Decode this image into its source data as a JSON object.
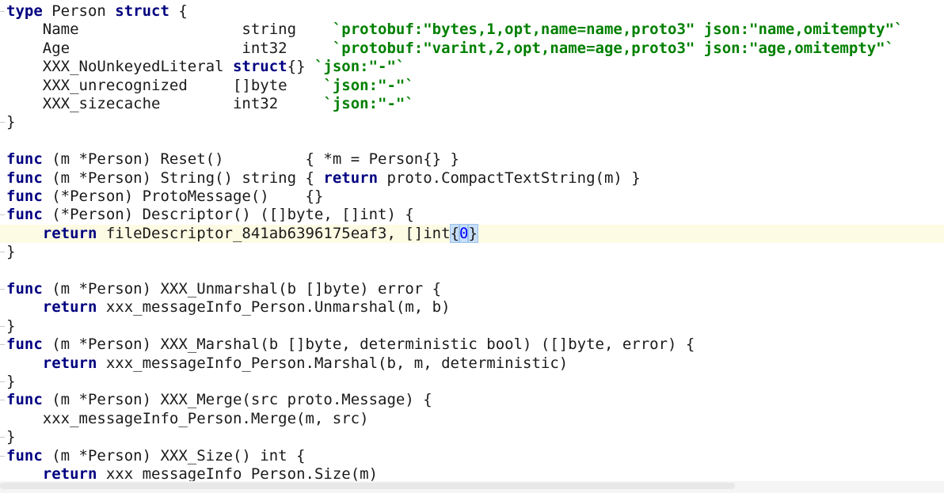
{
  "editor": {
    "lines": [
      {
        "segments": [
          {
            "t": "type",
            "c": "kw"
          },
          {
            "t": " Person "
          },
          {
            "t": "struct",
            "c": "kw"
          },
          {
            "t": " {"
          }
        ],
        "fold": true
      },
      {
        "segments": [
          {
            "t": "    Name                  string    "
          },
          {
            "t": "`protobuf:\"bytes,1,opt,name=name,proto3\" json:\"name,omitempty\"`",
            "c": "str"
          }
        ]
      },
      {
        "segments": [
          {
            "t": "    Age                   int32     "
          },
          {
            "t": "`protobuf:\"varint,2,opt,name=age,proto3\" json:\"age,omitempty\"`",
            "c": "str"
          }
        ]
      },
      {
        "segments": [
          {
            "t": "    XXX_NoUnkeyedLiteral "
          },
          {
            "t": "struct",
            "c": "kw"
          },
          {
            "t": "{} "
          },
          {
            "t": "`json:\"-\"`",
            "c": "str"
          }
        ]
      },
      {
        "segments": [
          {
            "t": "    XXX_unrecognized     []byte    "
          },
          {
            "t": "`json:\"-\"`",
            "c": "str"
          }
        ]
      },
      {
        "segments": [
          {
            "t": "    XXX_sizecache        int32     "
          },
          {
            "t": "`json:\"-\"`",
            "c": "str"
          }
        ]
      },
      {
        "segments": [
          {
            "t": "}"
          }
        ],
        "fold": true
      },
      {
        "segments": [
          {
            "t": ""
          }
        ]
      },
      {
        "segments": [
          {
            "t": "func",
            "c": "kw"
          },
          {
            "t": " (m *Person) Reset()         { *m = Person{} }"
          }
        ]
      },
      {
        "segments": [
          {
            "t": "func",
            "c": "kw"
          },
          {
            "t": " (m *Person) String() string { "
          },
          {
            "t": "return",
            "c": "kw"
          },
          {
            "t": " proto.CompactTextString(m) }"
          }
        ]
      },
      {
        "segments": [
          {
            "t": "func",
            "c": "kw"
          },
          {
            "t": " (*Person) ProtoMessage()    {}"
          }
        ]
      },
      {
        "segments": [
          {
            "t": "func",
            "c": "kw"
          },
          {
            "t": " (*Person) Descriptor() ([]byte, []int) {"
          }
        ],
        "fold": true
      },
      {
        "segments": [
          {
            "t": "    "
          },
          {
            "t": "return",
            "c": "kw"
          },
          {
            "t": " fileDescriptor_841ab6396175eaf3, []int"
          },
          {
            "t": "{",
            "c": "brace-hl"
          },
          {
            "t": "0",
            "c": "num brace-hl"
          },
          {
            "t": "}",
            "c": "brace-hl"
          }
        ],
        "current": true
      },
      {
        "segments": [
          {
            "t": "}"
          }
        ],
        "fold": true
      },
      {
        "segments": [
          {
            "t": ""
          }
        ]
      },
      {
        "segments": [
          {
            "t": "func",
            "c": "kw"
          },
          {
            "t": " (m *Person) XXX_Unmarshal(b []byte) error {"
          }
        ],
        "fold": true
      },
      {
        "segments": [
          {
            "t": "    "
          },
          {
            "t": "return",
            "c": "kw"
          },
          {
            "t": " xxx_messageInfo_Person.Unmarshal(m, b)"
          }
        ]
      },
      {
        "segments": [
          {
            "t": "}"
          }
        ],
        "fold": true
      },
      {
        "segments": [
          {
            "t": "func",
            "c": "kw"
          },
          {
            "t": " (m *Person) XXX_Marshal(b []byte, deterministic bool) ([]byte, error) {"
          }
        ],
        "fold": true
      },
      {
        "segments": [
          {
            "t": "    "
          },
          {
            "t": "return",
            "c": "kw"
          },
          {
            "t": " xxx_messageInfo_Person.Marshal(b, m, deterministic)"
          }
        ]
      },
      {
        "segments": [
          {
            "t": "}"
          }
        ],
        "fold": true
      },
      {
        "segments": [
          {
            "t": "func",
            "c": "kw"
          },
          {
            "t": " (m *Person) XXX_Merge(src proto.Message) {"
          }
        ],
        "fold": true
      },
      {
        "segments": [
          {
            "t": "    xxx_messageInfo_Person.Merge(m, src)"
          }
        ]
      },
      {
        "segments": [
          {
            "t": "}"
          }
        ],
        "fold": true
      },
      {
        "segments": [
          {
            "t": "func",
            "c": "kw"
          },
          {
            "t": " (m *Person) XXX_Size() int {"
          }
        ],
        "fold": true
      },
      {
        "segments": [
          {
            "t": "    "
          },
          {
            "t": "return",
            "c": "kw"
          },
          {
            "t": " xxx_messageInfo_Person.Size(m)"
          }
        ]
      }
    ]
  }
}
